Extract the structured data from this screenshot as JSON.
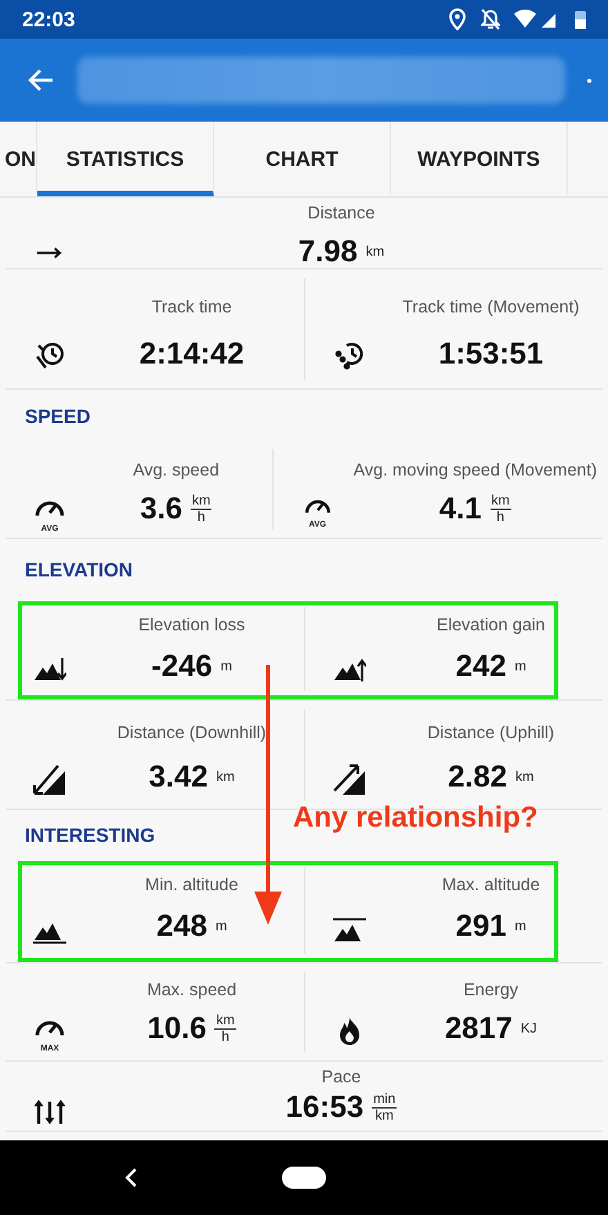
{
  "status_bar": {
    "time": "22:03"
  },
  "tabs": [
    {
      "label": "ON",
      "selected": false
    },
    {
      "label": "STATISTICS",
      "selected": true
    },
    {
      "label": "CHART",
      "selected": false
    },
    {
      "label": "WAYPOINTS",
      "selected": false
    }
  ],
  "sections": [
    {
      "rows": [
        {
          "highlighted": false,
          "cells": [
            {
              "label": "Distance",
              "value": "7.98",
              "unit": "km"
            }
          ]
        },
        {
          "highlighted": false,
          "cells": [
            {
              "label": "Track time",
              "value": "2:14:42"
            },
            {
              "label": "Track time (Movement)",
              "value": "1:53:51"
            }
          ]
        }
      ]
    },
    {
      "title": "SPEED",
      "rows": [
        {
          "highlighted": false,
          "cells": [
            {
              "label": "Avg. speed",
              "value": "3.6",
              "unit_fraction": [
                "km",
                "h"
              ],
              "icon_label": "AVG"
            },
            {
              "label": "Avg. moving speed (Movement)",
              "value": "4.1",
              "unit_fraction": [
                "km",
                "h"
              ],
              "icon_label": "AVG"
            }
          ]
        }
      ]
    },
    {
      "title": "ELEVATION",
      "rows": [
        {
          "highlighted": true,
          "cells": [
            {
              "label": "Elevation loss",
              "value": "-246",
              "unit": "m"
            },
            {
              "label": "Elevation gain",
              "value": "242",
              "unit": "m"
            }
          ]
        },
        {
          "highlighted": false,
          "cells": [
            {
              "label": "Distance (Downhill)",
              "value": "3.42",
              "unit": "km"
            },
            {
              "label": "Distance (Uphill)",
              "value": "2.82",
              "unit": "km"
            }
          ]
        }
      ]
    },
    {
      "title": "INTERESTING",
      "rows": [
        {
          "highlighted": true,
          "cells": [
            {
              "label": "Min. altitude",
              "value": "248",
              "unit": "m"
            },
            {
              "label": "Max. altitude",
              "value": "291",
              "unit": "m"
            }
          ]
        },
        {
          "highlighted": false,
          "cells": [
            {
              "label": "Max. speed",
              "value": "10.6",
              "unit_fraction": [
                "km",
                "h"
              ],
              "icon_label": "MAX"
            },
            {
              "label": "Energy",
              "value": "2817",
              "unit": "KJ"
            }
          ]
        },
        {
          "highlighted": false,
          "cells": [
            {
              "label": "Pace",
              "value": "16:53",
              "unit_fraction": [
                "min",
                "km"
              ]
            }
          ]
        }
      ]
    }
  ],
  "annotation": {
    "text": "Any relationship?"
  }
}
